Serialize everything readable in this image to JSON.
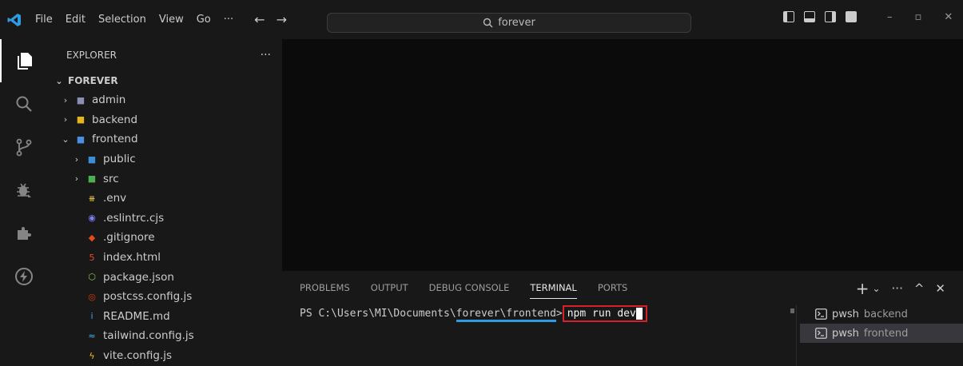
{
  "menu": {
    "items": [
      "File",
      "Edit",
      "Selection",
      "View",
      "Go"
    ],
    "more": "···"
  },
  "search": {
    "text": "forever"
  },
  "explorer": {
    "title": "EXPLORER",
    "more": "···",
    "root": "FOREVER",
    "items": [
      {
        "label": "admin",
        "chevron": "›",
        "icon": "folder-admin-icon",
        "color": "#8b8fb5"
      },
      {
        "label": "backend",
        "chevron": "›",
        "icon": "folder-backend-icon",
        "color": "#e6b422"
      },
      {
        "label": "frontend",
        "chevron": "⌄",
        "icon": "folder-frontend-icon",
        "color": "#4a8fe0"
      },
      {
        "label": "public",
        "chevron": "›",
        "icon": "folder-public-icon",
        "color": "#3b8fd9"
      },
      {
        "label": "src",
        "chevron": "›",
        "icon": "folder-src-icon",
        "color": "#4caf50"
      },
      {
        "label": ".env",
        "chevron": "",
        "icon": "env-file-icon",
        "color": "#e8c34a"
      },
      {
        "label": ".eslintrc.cjs",
        "chevron": "",
        "icon": "eslint-icon",
        "color": "#7b7ff0"
      },
      {
        "label": ".gitignore",
        "chevron": "",
        "icon": "git-icon",
        "color": "#e64a19"
      },
      {
        "label": "index.html",
        "chevron": "",
        "icon": "html-icon",
        "color": "#e44d26"
      },
      {
        "label": "package.json",
        "chevron": "",
        "icon": "nodejs-icon",
        "color": "#8bc34a"
      },
      {
        "label": "postcss.config.js",
        "chevron": "",
        "icon": "postcss-icon",
        "color": "#dd3a0a"
      },
      {
        "label": "README.md",
        "chevron": "",
        "icon": "info-icon",
        "color": "#42a5f5"
      },
      {
        "label": "tailwind.config.js",
        "chevron": "",
        "icon": "tailwind-icon",
        "color": "#38bdf8"
      },
      {
        "label": "vite.config.js",
        "chevron": "",
        "icon": "vite-icon",
        "color": "#ffc107"
      }
    ]
  },
  "panel": {
    "tabs": [
      "PROBLEMS",
      "OUTPUT",
      "DEBUG CONSOLE",
      "TERMINAL",
      "PORTS"
    ],
    "active_tab": "TERMINAL",
    "actions": {
      "add": "+",
      "dropdown": "⌄",
      "more": "···",
      "maximize": "^",
      "close": "✕"
    }
  },
  "terminal": {
    "prompt_prefix": "PS C:\\Users\\MI\\Documents\\",
    "prompt_underlined": "forever\\frontend",
    "prompt_suffix": ">",
    "command": "npm run dev"
  },
  "terminal_list": [
    {
      "shell": "pwsh",
      "name": "backend"
    },
    {
      "shell": "pwsh",
      "name": "frontend"
    }
  ]
}
